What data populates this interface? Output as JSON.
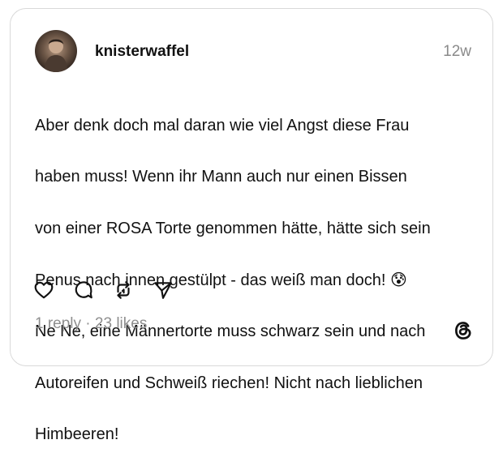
{
  "post": {
    "username": "knisterwaffel",
    "timestamp": "12w",
    "text_lines": [
      "Aber denk doch mal daran wie viel Angst diese Frau",
      "haben muss! Wenn ihr Mann auch nur einen Bissen",
      "von einer ROSA Torte genommen hätte, hätte sich sein",
      "Penus nach innen gestülpt - das weiß man doch! 😰",
      "Ne Ne, eine Männertorte muss schwarz sein und nach",
      "Autoreifen und Schweiß riechen! Nicht nach lieblichen",
      "Himbeeren!"
    ],
    "stats": "1 reply · 23 likes"
  },
  "actions": [
    {
      "name": "like-button",
      "icon": "heart-icon"
    },
    {
      "name": "reply-button",
      "icon": "comment-icon"
    },
    {
      "name": "repost-button",
      "icon": "repost-icon"
    },
    {
      "name": "share-button",
      "icon": "send-icon"
    }
  ],
  "branding": {
    "logo": "threads-logo-icon"
  },
  "colors": {
    "text": "#111111",
    "muted": "#8e8e8e",
    "border": "#d9d9d9",
    "background": "#ffffff"
  }
}
